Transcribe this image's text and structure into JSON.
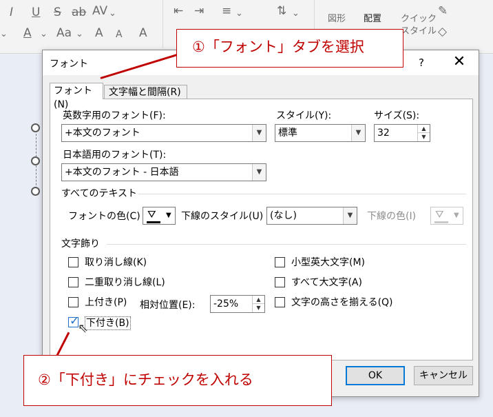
{
  "ribbon": {
    "row1": [
      {
        "name": "italic-icon",
        "glyph": "I"
      },
      {
        "name": "underline-icon",
        "glyph": "U"
      },
      {
        "name": "strikethrough-icon",
        "glyph": "S"
      },
      {
        "name": "shadow-text-icon",
        "glyph": "ab"
      },
      {
        "name": "char-spacing-icon",
        "glyph": "AV"
      }
    ],
    "row2": [
      {
        "name": "font-color-icon",
        "glyph": "A"
      },
      {
        "name": "change-case-icon",
        "glyph": "Aa"
      },
      {
        "name": "grow-font-icon",
        "glyph": "A"
      },
      {
        "name": "shrink-font-icon",
        "glyph": "A"
      },
      {
        "name": "clear-format-icon",
        "glyph": "A"
      }
    ],
    "shapes_label": "図形",
    "arrange_label": "配置",
    "quick_styles_label": "クイック",
    "quick_styles_label2": "スタイル"
  },
  "dialog": {
    "title": "フォント",
    "help": "?",
    "close": "✕",
    "tabs": [
      "フォント(N)",
      "文字幅と間隔(R)"
    ],
    "latin_font_label": "英数字用のフォント(F):",
    "latin_font_value": "+本文のフォント",
    "asian_font_label": "日本語用のフォント(T):",
    "asian_font_value": "+本文のフォント - 日本語",
    "style_label": "スタイル(Y):",
    "style_value": "標準",
    "size_label": "サイズ(S):",
    "size_value": "32",
    "all_text_label": "すべてのテキスト",
    "font_color_label": "フォントの色(C)",
    "underline_style_label": "下線のスタイル(U)",
    "underline_style_value": "(なし)",
    "underline_color_label": "下線の色(I)",
    "effects_label": "文字飾り",
    "effects": {
      "strikethrough": {
        "label": "取り消し線(K)",
        "checked": false
      },
      "double_strikethrough": {
        "label": "二重取り消し線(L)",
        "checked": false
      },
      "superscript": {
        "label": "上付き(P)",
        "checked": false
      },
      "offset_label": "相対位置(E):",
      "offset_value": "-25%",
      "subscript": {
        "label": "下付き(B)",
        "checked": true
      },
      "small_caps": {
        "label": "小型英大文字(M)",
        "checked": false
      },
      "all_caps": {
        "label": "すべて大文字(A)",
        "checked": false
      },
      "equalize_height": {
        "label": "文字の高さを揃える(Q)",
        "checked": false
      }
    },
    "ok": "OK",
    "cancel": "キャンセル"
  },
  "annotations": {
    "step1": "①「フォント」タブを選択",
    "step2": "②「下付き」にチェックを入れる"
  },
  "colors": {
    "annotation_red": "#c00000",
    "checkbox_blue": "#1e6fc9",
    "ok_border": "#0078d7"
  }
}
